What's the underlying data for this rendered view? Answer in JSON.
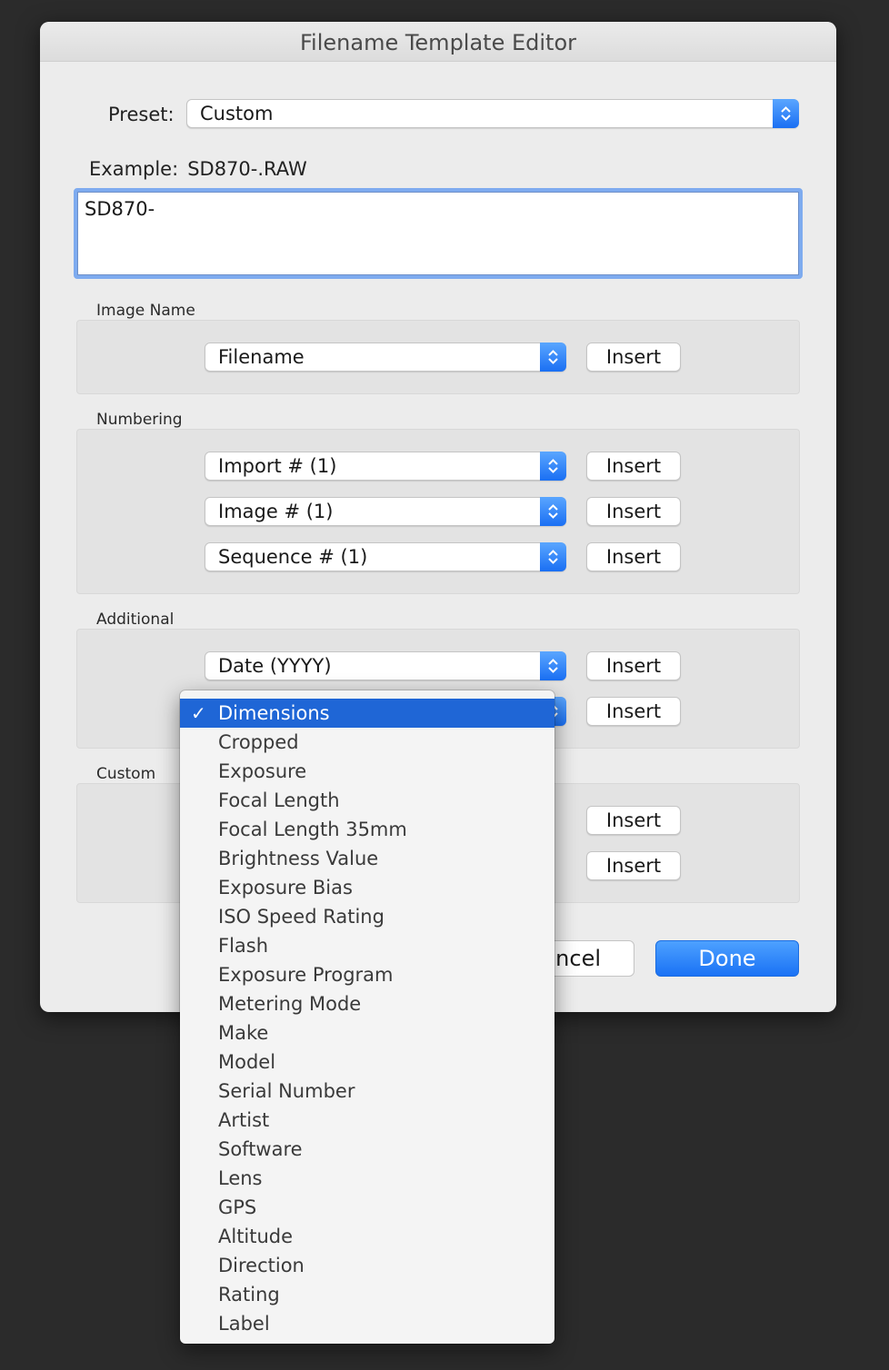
{
  "window": {
    "title": "Filename Template Editor"
  },
  "preset": {
    "label": "Preset:",
    "value": "Custom"
  },
  "example": {
    "label": "Example:",
    "value": "SD870-.RAW"
  },
  "template": {
    "text": "SD870-"
  },
  "sections": {
    "image_name": {
      "label": "Image Name",
      "rows": [
        {
          "value": "Filename",
          "button": "Insert"
        }
      ]
    },
    "numbering": {
      "label": "Numbering",
      "rows": [
        {
          "value": "Import # (1)",
          "button": "Insert"
        },
        {
          "value": "Image # (1)",
          "button": "Insert"
        },
        {
          "value": "Sequence # (1)",
          "button": "Insert"
        }
      ]
    },
    "additional": {
      "label": "Additional",
      "rows": [
        {
          "value": "Date (YYYY)",
          "button": "Insert"
        },
        {
          "value": "",
          "button": "Insert"
        }
      ]
    },
    "custom": {
      "label": "Custom",
      "rows": [
        {
          "button": "Insert"
        },
        {
          "button": "Insert"
        }
      ]
    }
  },
  "footer": {
    "cancel_label": "ncel",
    "done_label": "Done"
  },
  "menu": {
    "check_glyph": "✓",
    "selected": "Dimensions",
    "items": [
      "Dimensions",
      "Cropped",
      "Exposure",
      "Focal Length",
      "Focal Length 35mm",
      "Brightness Value",
      "Exposure Bias",
      "ISO Speed Rating",
      "Flash",
      "Exposure Program",
      "Metering Mode",
      "Make",
      "Model",
      "Serial Number",
      "Artist",
      "Software",
      "Lens",
      "GPS",
      "Altitude",
      "Direction",
      "Rating",
      "Label"
    ]
  },
  "colors": {
    "accent": "#1f66d6",
    "done_button": "#1a72f5",
    "background": "#2b2b2b"
  }
}
